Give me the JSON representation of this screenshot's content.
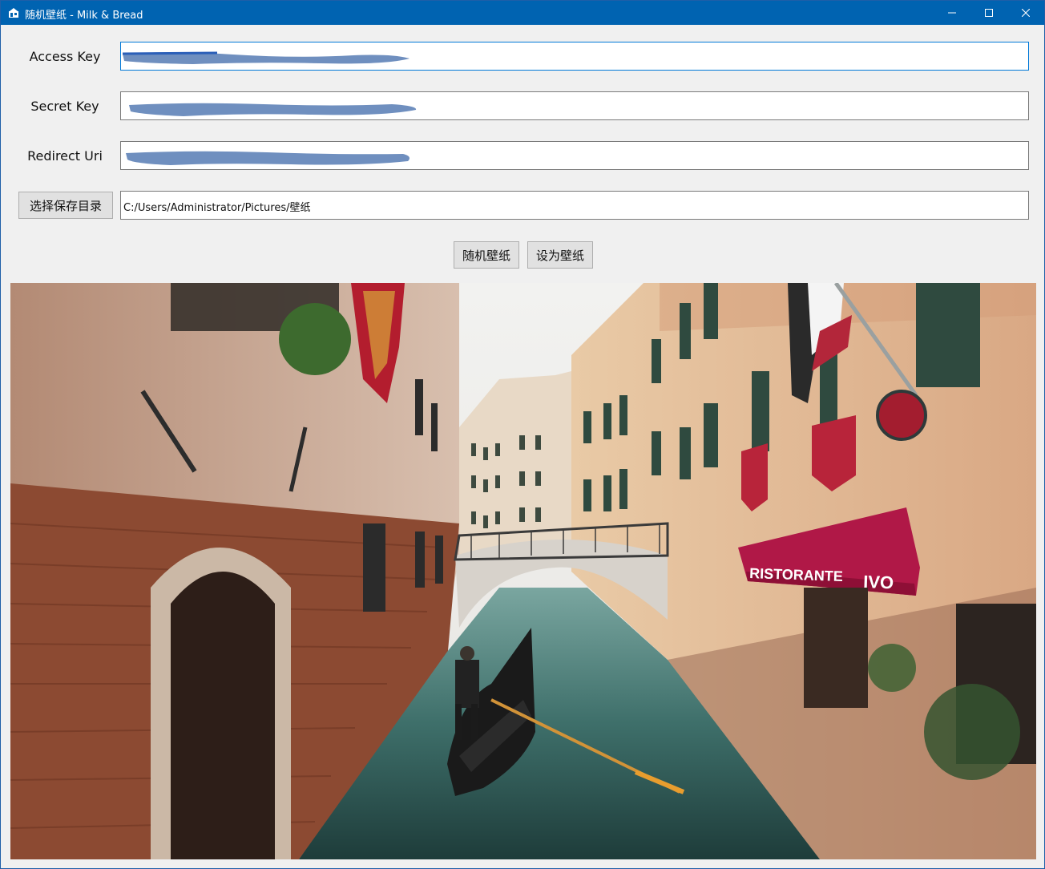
{
  "window": {
    "title": "随机壁纸 - Milk & Bread",
    "icon": "wallpaper-app-icon",
    "controls": {
      "minimize_icon": "minimize-icon",
      "maximize_icon": "maximize-icon",
      "close_icon": "close-icon"
    }
  },
  "form": {
    "access_key": {
      "label": "Access Key",
      "value": ""
    },
    "secret_key": {
      "label": "Secret Key",
      "value": ""
    },
    "redirect_uri": {
      "label": "Redirect Uri",
      "value": ""
    },
    "save_dir": {
      "button_label": "选择保存目录",
      "value": "C:/Users/Administrator/Pictures/壁纸"
    }
  },
  "actions": {
    "random_label": "随机壁纸",
    "set_label": "设为壁纸"
  },
  "preview": {
    "awning_text_left": "RISTORANTE",
    "awning_text_right": "IVO"
  },
  "colors": {
    "titlebar": "#0063b1",
    "redaction": "#6f8fbf",
    "awning": "#b01847"
  }
}
